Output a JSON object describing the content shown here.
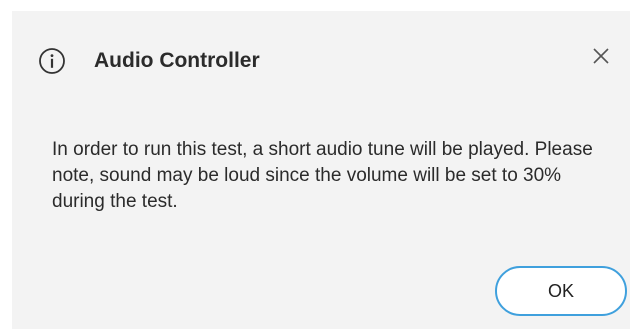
{
  "dialog": {
    "title": "Audio Controller",
    "icon": "info-icon",
    "close_icon": "close-icon",
    "message": "In order to run this test, a short audio tune will be played. Please note, sound may be loud since the volume will be set to 30% during the test.",
    "ok_label": "OK",
    "colors": {
      "background": "#f3f3f3",
      "button_border": "#3fa0dd",
      "text": "#2b2b2b"
    }
  }
}
